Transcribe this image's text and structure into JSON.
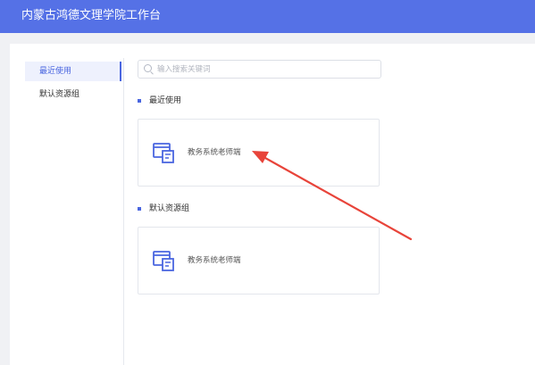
{
  "header": {
    "title": "内蒙古鸿德文理学院工作台"
  },
  "sidebar": {
    "items": [
      {
        "label": "最近使用",
        "active": true
      },
      {
        "label": "默认资源组",
        "active": false
      }
    ]
  },
  "search": {
    "placeholder": "输入搜索关键词",
    "value": ""
  },
  "sections": [
    {
      "title": "最近使用",
      "apps": [
        {
          "label": "教务系统老师端",
          "icon": "app-window-icon"
        }
      ]
    },
    {
      "title": "默认资源组",
      "apps": [
        {
          "label": "教务系统老师端",
          "icon": "app-window-icon"
        }
      ]
    }
  ],
  "colors": {
    "accent": "#5571e6",
    "active_text": "#4a66e0",
    "annotation_arrow": "#e8443a"
  }
}
